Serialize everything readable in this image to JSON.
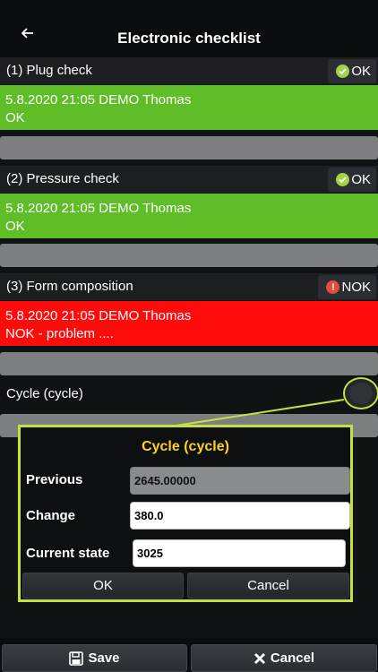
{
  "header": {
    "title": "Electronic checklist"
  },
  "items": [
    {
      "label": "(1) Plug check",
      "status": "OK",
      "result_line1": "5.8.2020 21:05 DEMO Thomas",
      "result_line2": "OK"
    },
    {
      "label": "(2) Pressure check",
      "status": "OK",
      "result_line1": "5.8.2020 21:05 DEMO Thomas",
      "result_line2": "OK"
    },
    {
      "label": "(3) Form composition",
      "status": "NOK",
      "result_line1": "5.8.2020 21:05 DEMO Thomas",
      "result_line2": "NOK - problem ...."
    }
  ],
  "cycle": {
    "label": "Cycle (cycle)"
  },
  "dialog": {
    "title": "Cycle (cycle)",
    "previous_label": "Previous",
    "previous_value": "2645.00000",
    "change_label": "Change",
    "change_value": "380.0",
    "current_label": "Current state",
    "current_value": "3025",
    "ok_label": "OK",
    "cancel_label": "Cancel"
  },
  "footer": {
    "save_label": "Save",
    "cancel_label": "Cancel"
  },
  "colors": {
    "ok_green": "#5fbe27",
    "nok_red": "#fe0c0c",
    "accent_lime": "#c6e03d",
    "dialog_title_yellow": "#ffd21a"
  }
}
